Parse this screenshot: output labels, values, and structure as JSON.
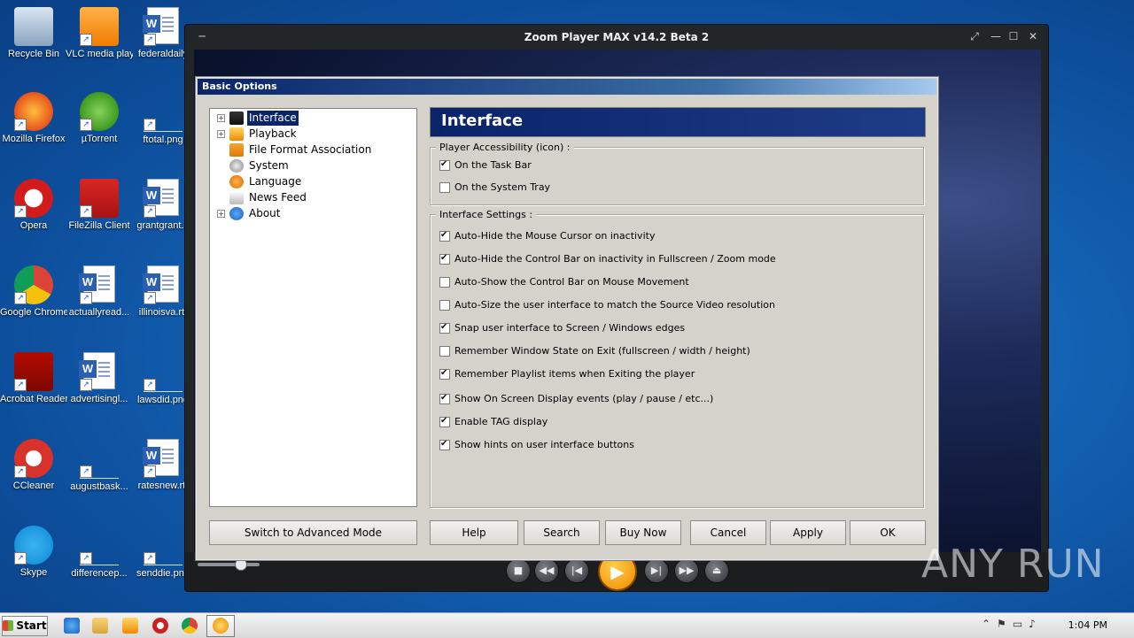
{
  "desktop": {
    "icons": [
      {
        "label": "Recycle Bin",
        "icon": "recycle-bin-icon"
      },
      {
        "label": "VLC media player",
        "icon": "vlc-icon"
      },
      {
        "label": "federaldaily",
        "icon": "word-doc-icon"
      },
      {
        "label": "Mozilla Firefox",
        "icon": "firefox-icon"
      },
      {
        "label": "µTorrent",
        "icon": "utorrent-icon"
      },
      {
        "label": "ftotal.png",
        "icon": "image-file-icon"
      },
      {
        "label": "Opera",
        "icon": "opera-icon"
      },
      {
        "label": "FileZilla Client",
        "icon": "filezilla-icon"
      },
      {
        "label": "grantgrant...",
        "icon": "word-doc-icon"
      },
      {
        "label": "Google Chrome",
        "icon": "chrome-icon"
      },
      {
        "label": "actuallyread...",
        "icon": "word-doc-icon"
      },
      {
        "label": "illinoisva.rtf",
        "icon": "word-doc-icon"
      },
      {
        "label": "Acrobat Reader DC",
        "icon": "acrobat-icon"
      },
      {
        "label": "advertisingl...",
        "icon": "word-doc-icon"
      },
      {
        "label": "lawsdid.png",
        "icon": "image-file-icon"
      },
      {
        "label": "CCleaner",
        "icon": "ccleaner-icon"
      },
      {
        "label": "augustbask...",
        "icon": "image-file-icon"
      },
      {
        "label": "ratesnew.rtf",
        "icon": "word-doc-icon"
      },
      {
        "label": "Skype",
        "icon": "skype-icon"
      },
      {
        "label": "differencep...",
        "icon": "image-file-icon"
      },
      {
        "label": "senddie.png",
        "icon": "image-file-icon"
      }
    ]
  },
  "player": {
    "title": "Zoom Player MAX v14.2 Beta 2",
    "colors": {
      "accent": "#f59a00",
      "frame": "#232629"
    }
  },
  "dialog": {
    "title": "Basic Options",
    "tree": [
      {
        "label": "Interface",
        "expandable": true,
        "selected": true
      },
      {
        "label": "Playback",
        "expandable": true
      },
      {
        "label": "File Format Association",
        "expandable": false
      },
      {
        "label": "System",
        "expandable": false
      },
      {
        "label": "Language",
        "expandable": false
      },
      {
        "label": "News Feed",
        "expandable": false
      },
      {
        "label": "About",
        "expandable": true
      }
    ],
    "heading": "Interface",
    "groups": [
      {
        "title": "Player Accessibility (icon) :",
        "options": [
          {
            "label": "On the Task Bar",
            "checked": true
          },
          {
            "label": "On the System Tray",
            "checked": false
          }
        ]
      },
      {
        "title": "Interface Settings :",
        "options": [
          {
            "label": "Auto-Hide the Mouse Cursor on inactivity",
            "checked": true
          },
          {
            "label": "Auto-Hide the Control Bar on inactivity in Fullscreen / Zoom mode",
            "checked": true
          },
          {
            "label": "Auto-Show the Control Bar on Mouse Movement",
            "checked": false
          },
          {
            "label": "Auto-Size the user interface to match the Source Video resolution",
            "checked": false
          },
          {
            "label": "Snap user interface to Screen / Windows edges",
            "checked": true
          },
          {
            "label": "Remember Window State on Exit (fullscreen / width / height)",
            "checked": false
          },
          {
            "label": "Remember Playlist items when Exiting the player",
            "checked": true
          },
          {
            "label": "Show On Screen Display events (play / pause / etc...)",
            "checked": true
          },
          {
            "label": "Enable TAG display",
            "checked": true
          },
          {
            "label": "Show hints on user interface buttons",
            "checked": true
          }
        ]
      }
    ],
    "buttons": {
      "advanced": "Switch to Advanced Mode",
      "help": "Help",
      "search": "Search",
      "buy": "Buy Now",
      "cancel": "Cancel",
      "apply": "Apply",
      "ok": "OK"
    }
  },
  "taskbar": {
    "start": "Start",
    "clock": "1:04 PM"
  },
  "watermark": "ANY RUN"
}
